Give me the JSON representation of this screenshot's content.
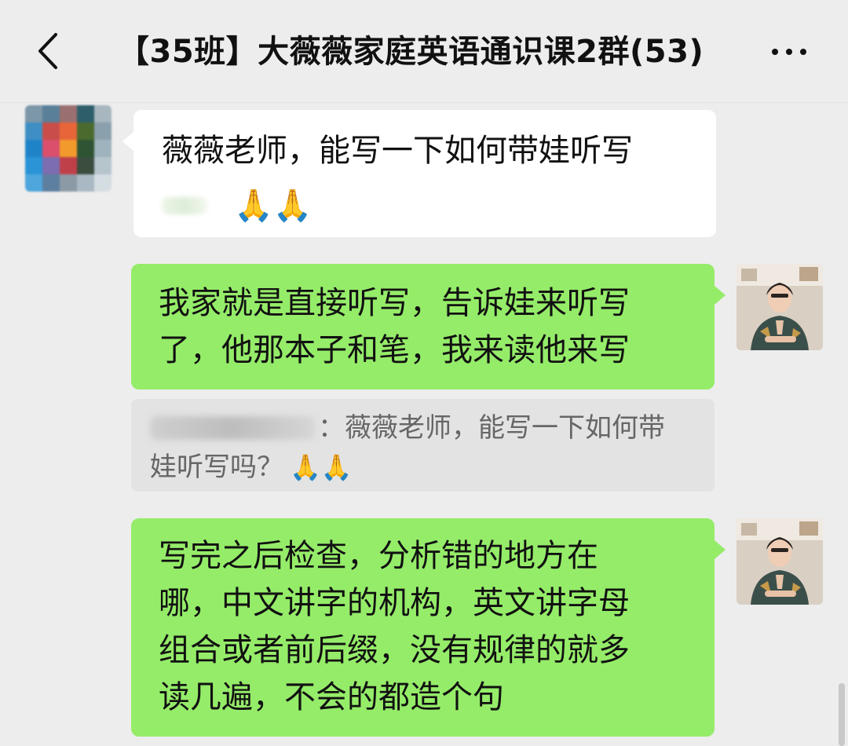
{
  "header": {
    "title": "【35班】大薇薇家庭英语通识课2群(53)",
    "back_icon": "chevron-left-icon",
    "more_icon": "more-dots-icon"
  },
  "messages": [
    {
      "sender": "other",
      "text": "薇薇老师，能写一下如何带娃听写",
      "emoji": "🙏🙏"
    },
    {
      "sender": "self",
      "lines": [
        "我家就是直接听写，告诉娃来听写",
        "了，他那本子和笔，我来读他来写"
      ]
    },
    {
      "type": "quote",
      "prefix": "：",
      "line1": "薇薇老师，能写一下如何带",
      "line2": "娃听写吗？",
      "emoji": "🙏🙏"
    },
    {
      "sender": "self",
      "lines": [
        "写完之后检查，分析错的地方在",
        "哪，中文讲字的机构，英文讲字母",
        "组合或者前后缀，没有规律的就多",
        "读几遍，不会的都造个句"
      ]
    }
  ],
  "colors": {
    "background": "#ededed",
    "bubble_self": "#95ec69",
    "bubble_other": "#ffffff",
    "quote_bg": "#e3e3e3"
  }
}
